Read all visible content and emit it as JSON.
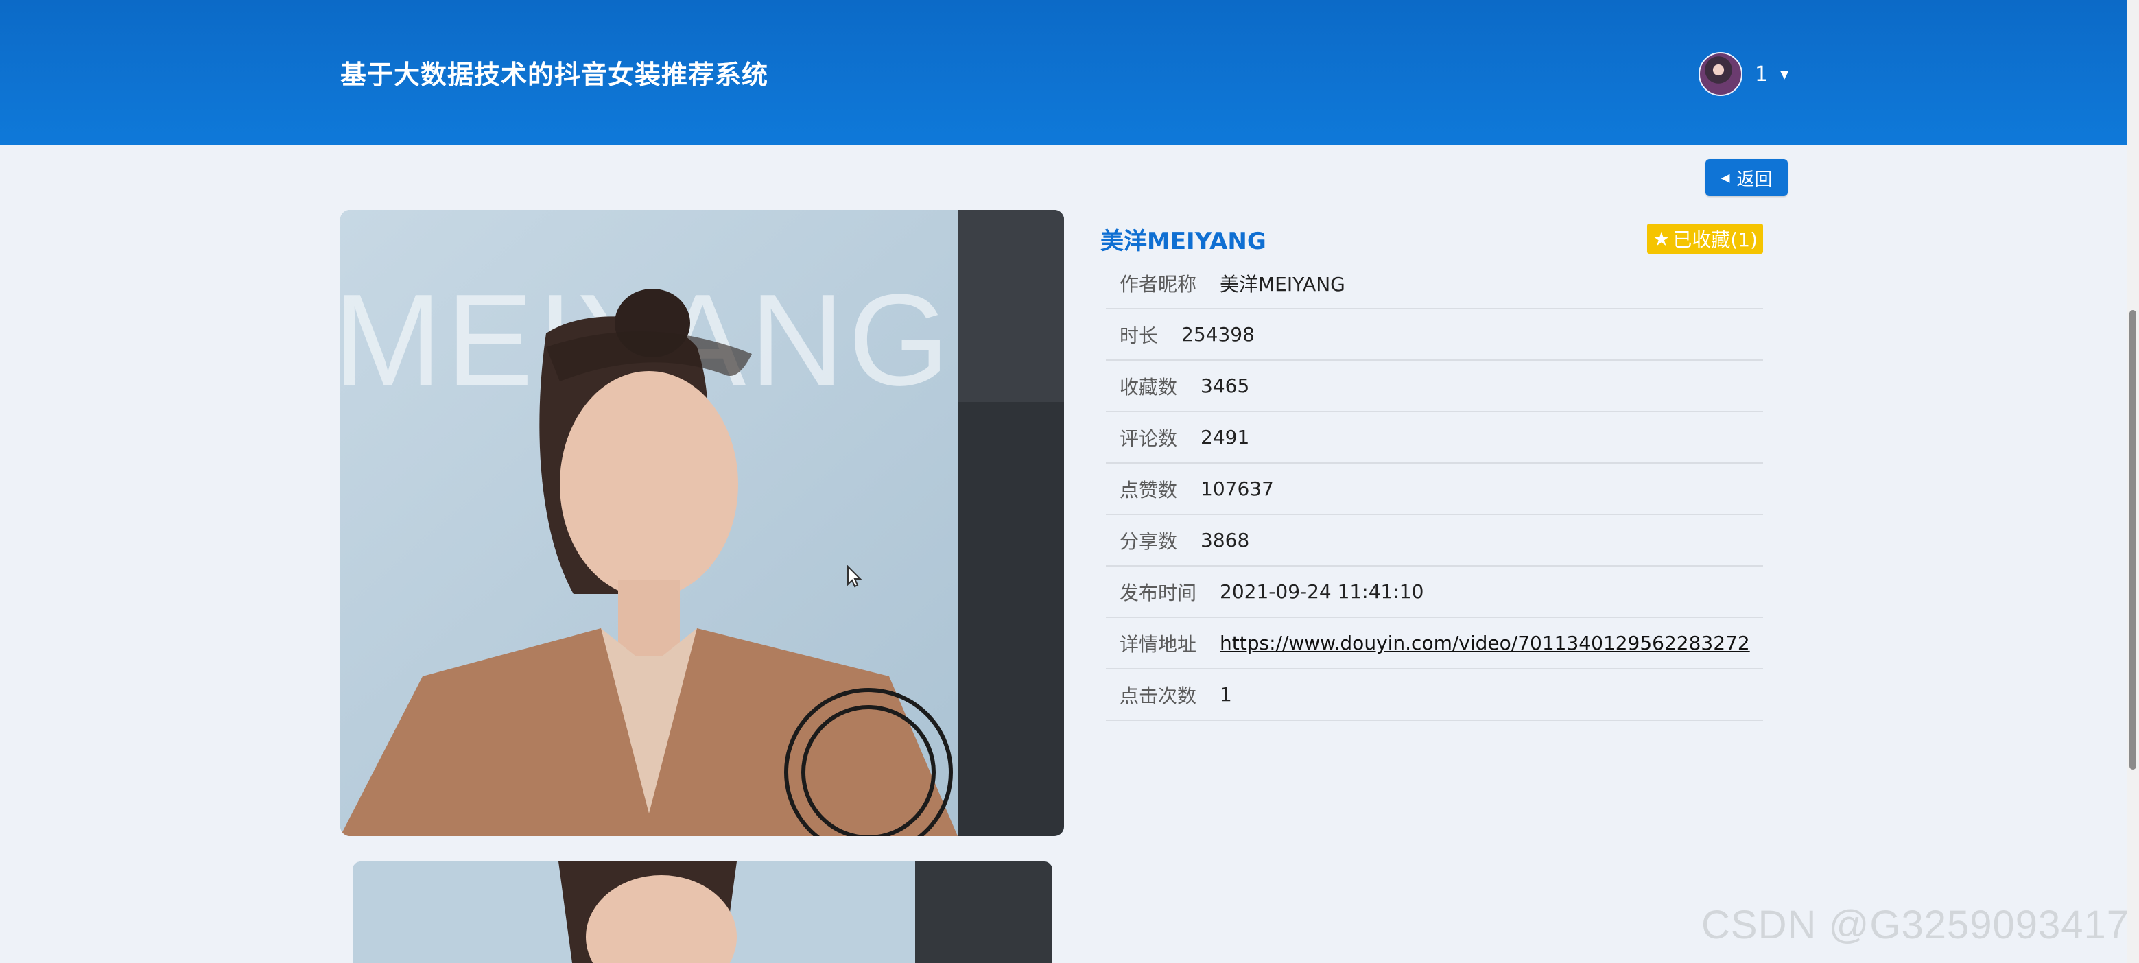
{
  "header": {
    "brand": "基于大数据技术的抖音女装推荐系统",
    "user_name": "1",
    "caret": "▾"
  },
  "actions": {
    "back_label": "返回",
    "back_icon": "◂"
  },
  "video": {
    "title": "美洋MEIYANG",
    "favorite_label": "已收藏(1)",
    "favorite_icon": "★",
    "image_text": "MEIYANG",
    "fields": [
      {
        "label": "作者昵称",
        "value": "美洋MEIYANG"
      },
      {
        "label": "时长",
        "value": "254398"
      },
      {
        "label": "收藏数",
        "value": "3465"
      },
      {
        "label": "评论数",
        "value": "2491"
      },
      {
        "label": "点赞数",
        "value": "107637"
      },
      {
        "label": "分享数",
        "value": "3868"
      },
      {
        "label": "发布时间",
        "value": "2021-09-24 11:41:10"
      },
      {
        "label": "详情地址",
        "value": "https://www.douyin.com/video/7011340129562283272"
      },
      {
        "label": "点击次数",
        "value": "1"
      }
    ]
  },
  "watermark": "CSDN @G3259093417",
  "colors": {
    "header": "#0f74d6",
    "accent": "#0f6fd2",
    "badge": "#f5c400",
    "background": "#eef2f8"
  }
}
